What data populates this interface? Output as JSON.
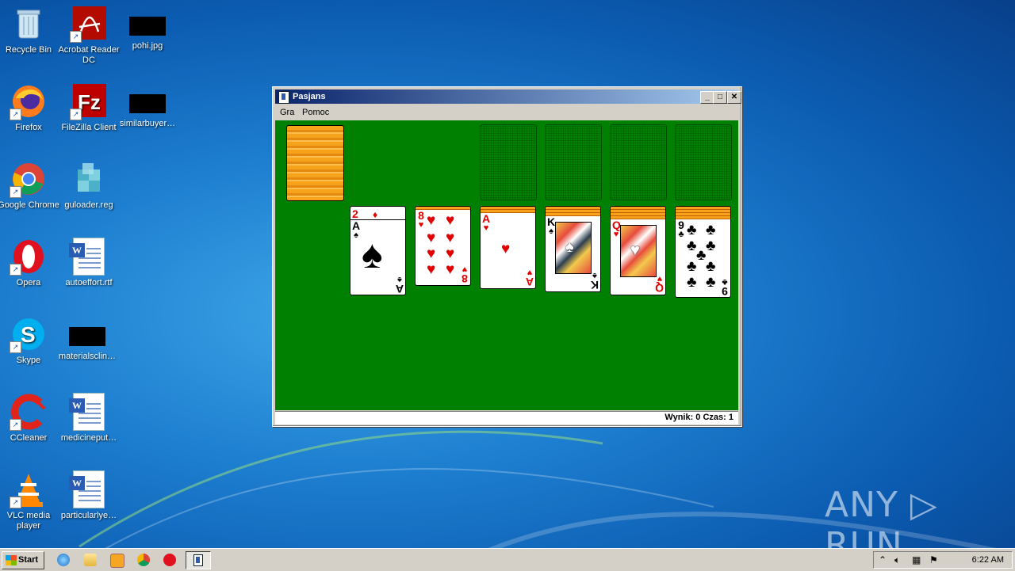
{
  "desktop": {
    "icons": [
      {
        "label": "Recycle Bin"
      },
      {
        "label": "Acrobat Reader DC"
      },
      {
        "label": "pohi.jpg"
      },
      {
        "label": "Firefox"
      },
      {
        "label": "FileZilla Client"
      },
      {
        "label": "similarbuyer…"
      },
      {
        "label": "Google Chrome"
      },
      {
        "label": "guloader.reg"
      },
      {
        "label": "Opera"
      },
      {
        "label": "autoeffort.rtf"
      },
      {
        "label": "Skype"
      },
      {
        "label": "materialsclin…"
      },
      {
        "label": "CCleaner"
      },
      {
        "label": "medicineput…"
      },
      {
        "label": "VLC media player"
      },
      {
        "label": "particularlye…"
      }
    ],
    "watermark": "ANY ▷ RUN"
  },
  "window": {
    "title": "Pasjans",
    "controls": {
      "minimize": "_",
      "maximize": "□",
      "close": "✕"
    },
    "menu": [
      "Gra",
      "Pomoc"
    ],
    "status": "Wynik: 0 Czas: 1"
  },
  "game": {
    "tableau": [
      {
        "rank": "A",
        "suit": "♠",
        "color": "black",
        "under_rank": "2",
        "under_suit": "♦"
      },
      {
        "rank": "8",
        "suit": "♥",
        "color": "red"
      },
      {
        "rank": "A",
        "suit": "♥",
        "color": "red"
      },
      {
        "rank": "K",
        "suit": "♠",
        "color": "black"
      },
      {
        "rank": "Q",
        "suit": "♥",
        "color": "red"
      },
      {
        "rank": "9",
        "suit": "♣",
        "color": "black"
      }
    ]
  },
  "taskbar": {
    "start_label": "Start",
    "clock": "6:22 AM"
  },
  "colors": {
    "felt": "#008000",
    "card_back": "#f7a21b",
    "red_suit": "#e00000"
  }
}
